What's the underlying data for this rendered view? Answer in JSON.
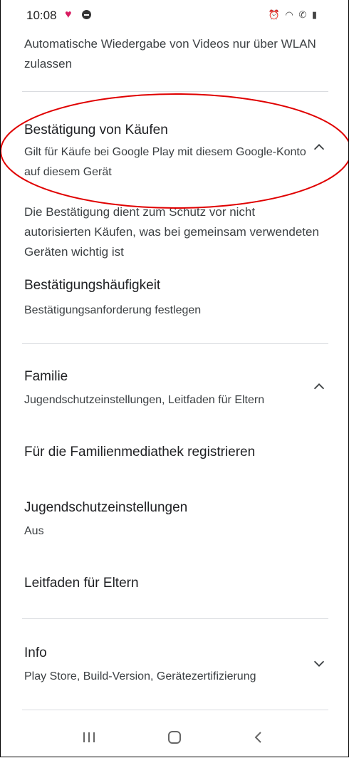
{
  "status_bar": {
    "time": "10:08",
    "right_icons": "alarm, wifi, call, signal, battery"
  },
  "previous_setting": {
    "text": "Automatische Wiedergabe von Videos nur über WLAN zulassen"
  },
  "purchase_confirmation": {
    "title": "Bestätigung von Käufen",
    "subtitle": "Gilt für Käufe bei Google Play mit diesem Google-Konto auf diesem Gerät",
    "chevron": "chevron-up-icon",
    "description": "Die Bestätigung dient zum Schutz vor nicht autorisierten Käufen, was bei gemeinsam verwendeten Geräten wichtig ist",
    "frequency_title": "Bestätigungshäufigkeit",
    "frequency_subtitle": "Bestätigungsanforderung festlegen"
  },
  "family": {
    "title": "Familie",
    "subtitle": "Jugendschutzeinstellungen, Leitfaden für Eltern",
    "chevron": "chevron-up-icon",
    "items": [
      {
        "title": "Für die Familienmediathek registrieren"
      },
      {
        "title": "Jugendschutzeinstellungen",
        "subtitle": "Aus"
      },
      {
        "title": "Leitfaden für Eltern"
      }
    ]
  },
  "info": {
    "title": "Info",
    "subtitle": "Play Store, Build-Version, Gerätezertifizierung",
    "chevron": "chevron-down-icon"
  },
  "nav_bar": {
    "recents": "recents-icon",
    "home": "home-icon",
    "back": "back-icon"
  },
  "annotation": {
    "color": "#e00000"
  }
}
